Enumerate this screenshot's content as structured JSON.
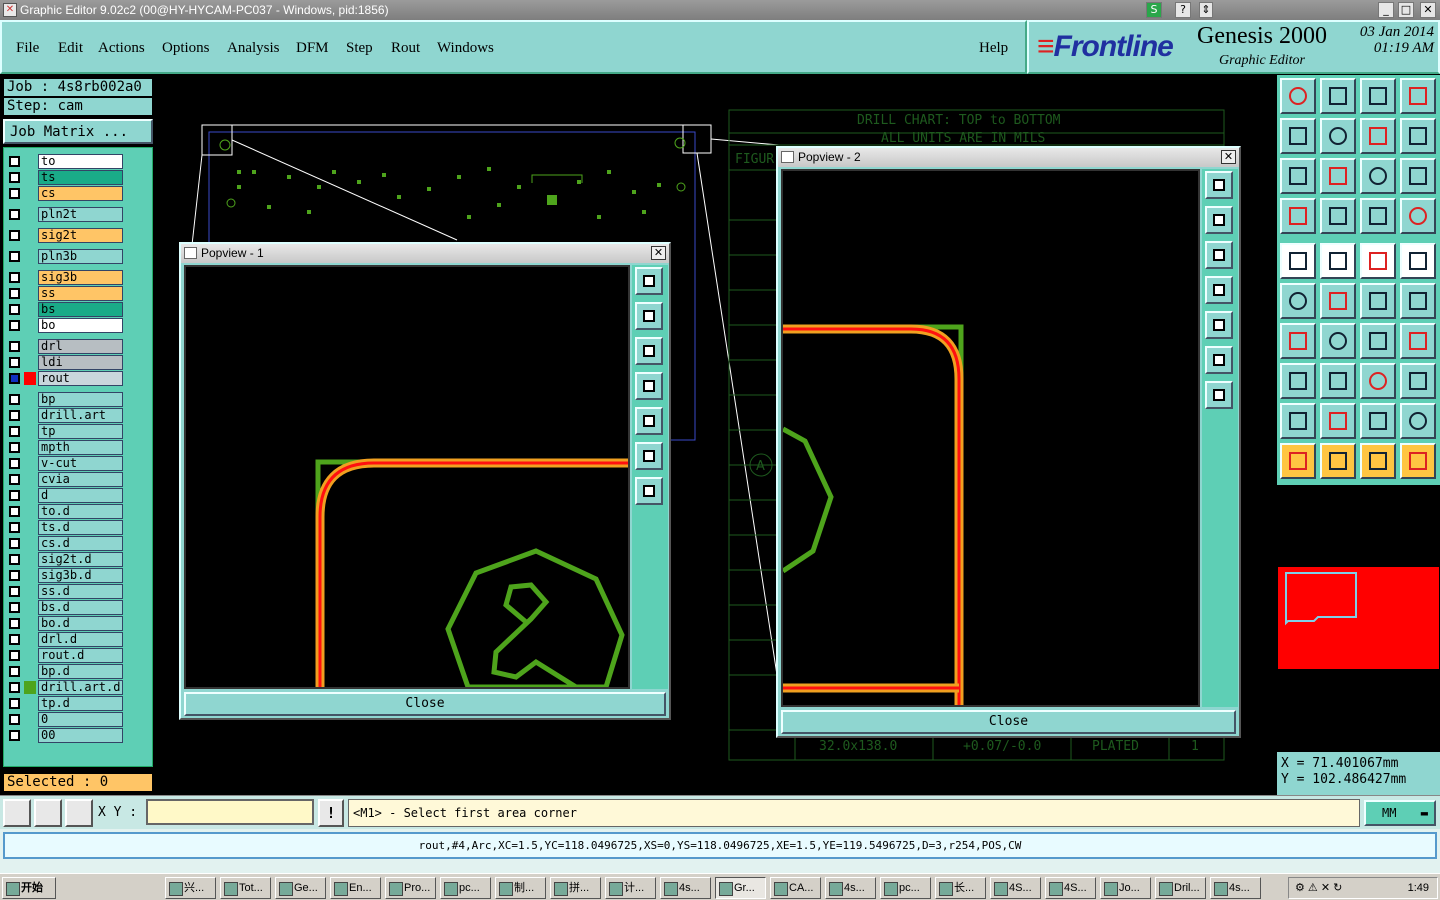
{
  "window": {
    "title": "Graphic Editor 9.02c2 (00@HY-HYCAM-PC037 - Windows, pid:1856)"
  },
  "menu": {
    "file": "File",
    "edit": "Edit",
    "actions": "Actions",
    "options": "Options",
    "analysis": "Analysis",
    "dfm": "DFM",
    "step": "Step",
    "rout": "Rout",
    "windows": "Windows",
    "help": "Help"
  },
  "brand": {
    "logo": "Frontline",
    "product": "Genesis 2000",
    "subtitle": "Graphic Editor",
    "date": "03 Jan 2014",
    "time": "01:19 AM"
  },
  "job": {
    "job_label": "Job : 4s8rb002a0",
    "step_label": "Step: cam",
    "matrix_button": "Job Matrix ..."
  },
  "layers": [
    {
      "name": "to",
      "color": "white"
    },
    {
      "name": "ts",
      "color": "teal"
    },
    {
      "name": "cs",
      "color": "orange"
    },
    {
      "name": "pln2t",
      "color": "aqua"
    },
    {
      "name": "sig2t",
      "color": "orange"
    },
    {
      "name": "pln3b",
      "color": "aqua"
    },
    {
      "name": "sig3b",
      "color": "orange"
    },
    {
      "name": "ss",
      "color": "orange"
    },
    {
      "name": "bs",
      "color": "teal"
    },
    {
      "name": "bo",
      "color": "white"
    },
    {
      "name": "drl",
      "color": "gray"
    },
    {
      "name": "ldi",
      "color": "gray"
    },
    {
      "name": "rout",
      "color": "light"
    },
    {
      "name": "bp",
      "color": "aqua"
    },
    {
      "name": "drill.art",
      "color": "aqua"
    },
    {
      "name": "tp",
      "color": "aqua"
    },
    {
      "name": "mpth",
      "color": "aqua"
    },
    {
      "name": "v-cut",
      "color": "aqua"
    },
    {
      "name": "cvia",
      "color": "aqua"
    },
    {
      "name": "d",
      "color": "aqua"
    },
    {
      "name": "to.d",
      "color": "aqua"
    },
    {
      "name": "ts.d",
      "color": "aqua"
    },
    {
      "name": "cs.d",
      "color": "aqua"
    },
    {
      "name": "sig2t.d",
      "color": "aqua"
    },
    {
      "name": "sig3b.d",
      "color": "aqua"
    },
    {
      "name": "ss.d",
      "color": "aqua"
    },
    {
      "name": "bs.d",
      "color": "aqua"
    },
    {
      "name": "bo.d",
      "color": "aqua"
    },
    {
      "name": "drl.d",
      "color": "aqua"
    },
    {
      "name": "rout.d",
      "color": "aqua"
    },
    {
      "name": "bp.d",
      "color": "aqua"
    },
    {
      "name": "drill.art.d",
      "color": "aqua"
    },
    {
      "name": "tp.d",
      "color": "aqua"
    },
    {
      "name": "0",
      "color": "aqua"
    },
    {
      "name": "00",
      "color": "aqua"
    }
  ],
  "selected": "Selected : 0",
  "drill_chart": {
    "title1": "DRILL CHART: TOP to BOTTOM",
    "title2": "ALL UNITS ARE IN MILS",
    "col_header": "FIGUR",
    "last_row": {
      "size": "32.0x138.0",
      "tol": "+0.07/-0.0",
      "plated": "PLATED",
      "qty": "1"
    }
  },
  "popup1": {
    "title": "Popview - 1",
    "close_label": "Close"
  },
  "popup2": {
    "title": "Popview - 2",
    "close_label": "Close"
  },
  "coords": {
    "x": "X = 71.401067mm",
    "y": "Y = 102.486427mm"
  },
  "command": {
    "xy_label": "X Y :",
    "bang": "!",
    "prompt": "<M1> - Select first area corner",
    "unit": "MM"
  },
  "info": "rout,#4,Arc,XC=1.5,YC=118.0496725,XS=0,YS=118.0496725,XE=1.5,YE=119.5496725,D=3,r254,POS,CW",
  "taskbar": {
    "start": "开始",
    "items": [
      "兴...",
      "Tot...",
      "Ge...",
      "En...",
      "Pro...",
      "pc...",
      "制...",
      "拼...",
      "计...",
      "4s...",
      "Gr...",
      "CA...",
      "4s...",
      "pc...",
      "长...",
      "4S...",
      "4S...",
      "Jo...",
      "Dril...",
      "4s..."
    ],
    "clock": "1:49"
  },
  "colors": {
    "accent": "#8fd6d0",
    "panel": "#5ecfb5",
    "rout_green": "#4ea41c",
    "rout_red": "#ff1010",
    "rout_orange": "#f0a020"
  }
}
